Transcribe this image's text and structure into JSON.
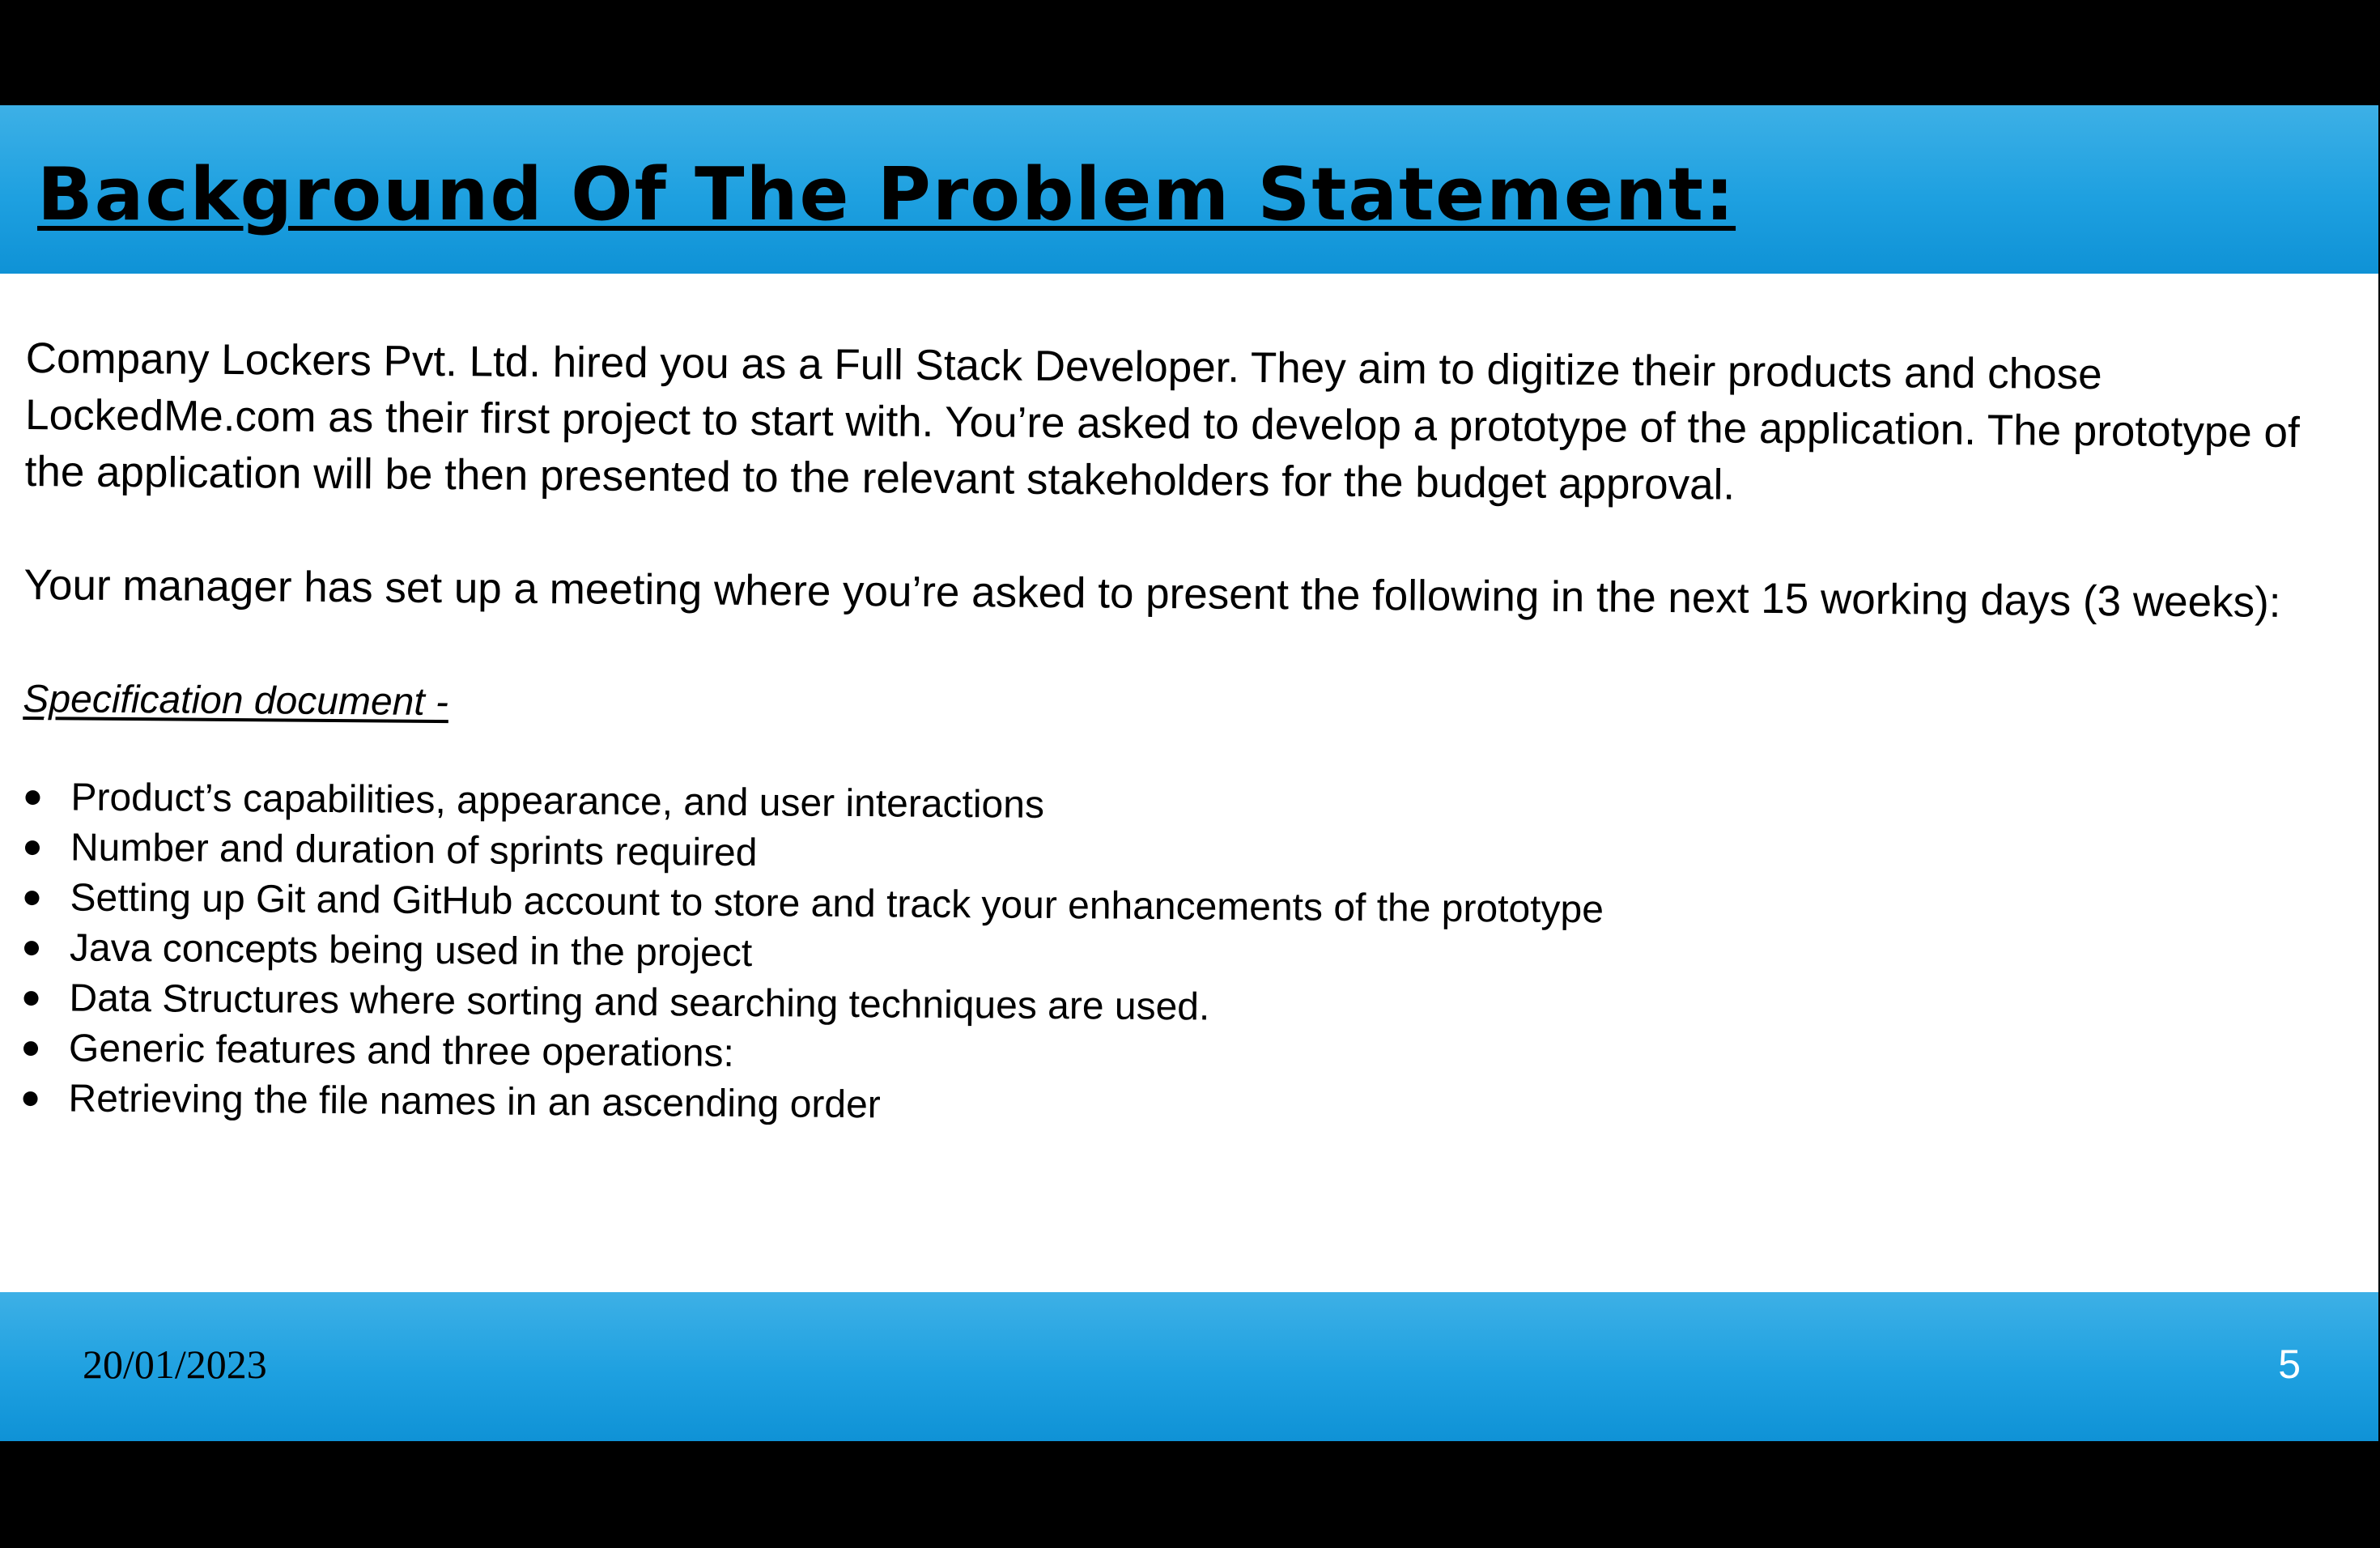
{
  "slide": {
    "title": "Background Of The Problem Statement:",
    "paragraphs": [
      "Company Lockers Pvt. Ltd. hired you as a Full Stack Developer. They aim to digitize their products and chose LockedMe.com as their first project to start with. You’re asked to develop a prototype of the application. The prototype of the application will be then presented to the relevant stakeholders for the budget approval.",
      "Your manager has set up a meeting where you’re asked to present the following in the next 15 working days (3 weeks):"
    ],
    "spec_heading": "Specification document - ",
    "bullets": [
      "Product’s capabilities, appearance, and user interactions",
      "Number and duration of sprints required",
      "Setting up Git and GitHub account to store and track your enhancements of the prototype",
      "Java concepts being used in the project",
      "Data Structures where sorting and searching techniques are used.",
      "Generic features and three operations:",
      "Retrieving the file names in an ascending order"
    ]
  },
  "footer": {
    "date": "20/01/2023",
    "page_number": "5"
  },
  "colors": {
    "band_blue": "#1ea0e0",
    "band_blue_light": "#3db0e6",
    "letterbox": "#000000",
    "slide_background": "#ffffff",
    "page_number_text": "#ffffff"
  }
}
